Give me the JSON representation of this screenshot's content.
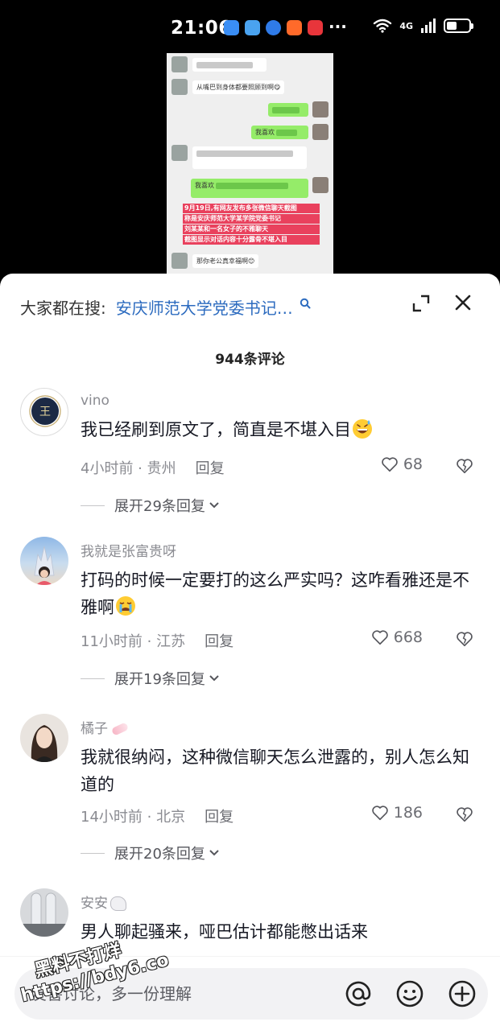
{
  "status_bar": {
    "time": "21:06",
    "more": "···",
    "network": "4G",
    "app_icons": [
      "message-icon",
      "wifi-app-icon",
      "browser-icon",
      "taobao-icon",
      "huawei-icon"
    ],
    "app_icon_colors": [
      "#3a8ef5",
      "#4aa3f0",
      "#2f7be8",
      "#ff6a2a",
      "#e8353b"
    ]
  },
  "video": {
    "bubbles": [
      {
        "side": "left",
        "text": ""
      },
      {
        "side": "left",
        "text": "从嘴巴到身体都要照顾到啊😋"
      },
      {
        "side": "right",
        "text": ""
      },
      {
        "side": "right",
        "text": "我喜欢"
      },
      {
        "side": "left",
        "text": ""
      },
      {
        "side": "right",
        "text": "我喜欢"
      },
      {
        "side": "left",
        "text": "那你老公真幸福啊😊"
      }
    ],
    "caption_lines": [
      "9月19日,有网友发布多张微信聊天截图",
      "称是安庆师范大学某学院党委书记",
      "刘某某和一名女子的不雅聊天",
      "截图显示对话内容十分露骨不堪入目"
    ]
  },
  "search": {
    "prefix": "大家都在搜:",
    "query": "安庆师范大学党委书记…"
  },
  "comments_header": {
    "count_title": "944条评论"
  },
  "comments": [
    {
      "name": "vino",
      "text": "我已经刷到原文了，简直是不堪入目",
      "emoji": "sweat-smile-emoji",
      "time": "4小时前 · 贵州",
      "reply": "回复",
      "likes": "68",
      "expand": "展开29条回复"
    },
    {
      "name": "我就是张富贵呀",
      "text": "打码的时候一定要打的这么严实吗？这咋看雅还是不雅啊",
      "emoji": "crying-emoji",
      "time": "11小时前 · 江苏",
      "reply": "回复",
      "likes": "668",
      "expand": "展开19条回复"
    },
    {
      "name": "橘子",
      "text": "我就很纳闷，这种微信聊天怎么泄露的，别人怎么知道的",
      "emoji": "",
      "time": "14小时前 · 北京",
      "reply": "回复",
      "likes": "186",
      "expand": "展开20条回复"
    },
    {
      "name": "安安",
      "text": "男人聊起骚来，哑巴估计都能憋出话来",
      "emoji": "",
      "time": "",
      "reply": "",
      "likes": "",
      "expand": ""
    }
  ],
  "input": {
    "placeholder": "友善讨论，多一份理解"
  },
  "watermark": {
    "line1": "黑料不打烊",
    "line2": "https://bdy6.co"
  },
  "colors": {
    "link_blue": "#2c6bbf",
    "caption_red": "#e83250",
    "wechat_green": "#95ec69"
  }
}
